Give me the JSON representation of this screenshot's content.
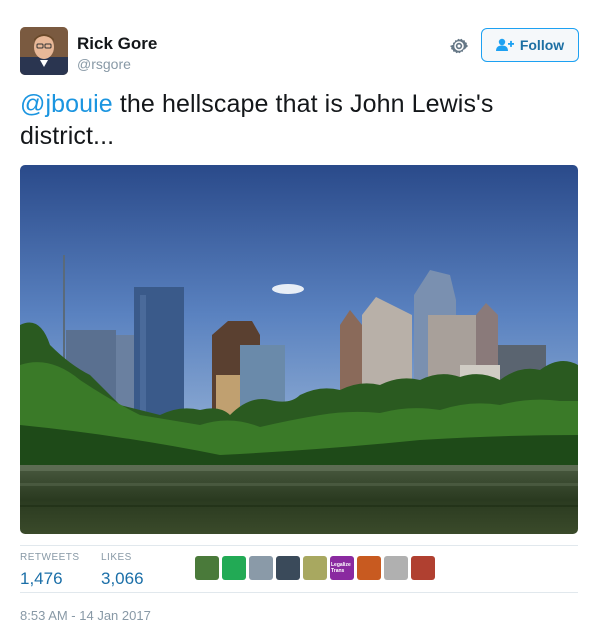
{
  "user": {
    "name": "Rick Gore",
    "handle": "@rsgore"
  },
  "follow_button": {
    "label": "Follow"
  },
  "tweet": {
    "mention": "@jbouie",
    "text": " the hellscape that is John Lewis's district..."
  },
  "stats": {
    "retweets_label": "RETWEETS",
    "retweets_value": "1,476",
    "likes_label": "LIKES",
    "likes_value": "3,066"
  },
  "likers": [
    {
      "name": "liker-avatar-1",
      "color": "#4a7a3a"
    },
    {
      "name": "liker-avatar-2",
      "color": "#22aa55"
    },
    {
      "name": "liker-avatar-3",
      "color": "#8a9aa8"
    },
    {
      "name": "liker-avatar-4",
      "color": "#3a4a5a"
    },
    {
      "name": "liker-avatar-5",
      "color": "#a8a860"
    },
    {
      "name": "liker-avatar-6",
      "color": "#8a2aa0",
      "text": "Legalize Trans"
    },
    {
      "name": "liker-avatar-7",
      "color": "#c85a20"
    },
    {
      "name": "liker-avatar-8",
      "color": "#b0b0b0"
    },
    {
      "name": "liker-avatar-9",
      "color": "#b04030"
    }
  ],
  "timestamp": "8:53 AM - 14 Jan 2017",
  "colors": {
    "accent": "#1da1f2",
    "link": "#1b95e0",
    "muted": "#8899a6"
  },
  "icons": {
    "settings": "gear-icon",
    "follow": "add-user-icon"
  }
}
